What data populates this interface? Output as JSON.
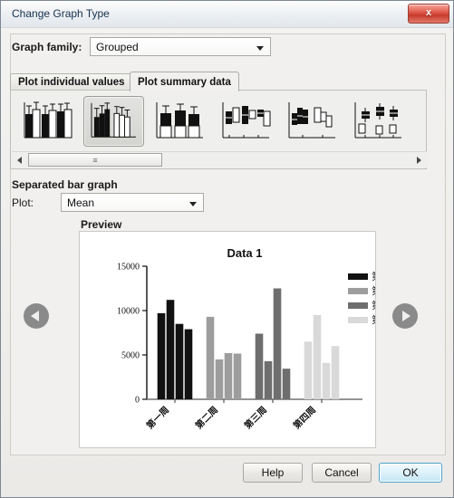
{
  "window": {
    "title": "Change Graph Type",
    "close_icon": "close-icon",
    "close_label": "x"
  },
  "form": {
    "graph_family_label": "Graph family:",
    "graph_family_value": "Grouped",
    "graph_family_caret": "chevron-down-icon"
  },
  "tabs": [
    {
      "label": "Plot individual values",
      "selected": false
    },
    {
      "label": "Plot summary data",
      "selected": true
    }
  ],
  "thumbnails": {
    "items": [
      {
        "name": "interleaved-bar-graph",
        "selected": false
      },
      {
        "name": "separated-bar-graph",
        "selected": true
      },
      {
        "name": "stacked-bar-graph",
        "selected": false
      },
      {
        "name": "interleaved-box-plot",
        "selected": false
      },
      {
        "name": "separated-box-plot",
        "selected": false
      },
      {
        "name": "grouped-scatter-box",
        "selected": false
      }
    ],
    "scroll_left_icon": "triangle-left-icon",
    "scroll_right_icon": "triangle-right-icon",
    "scroll_grip": "≡"
  },
  "section": {
    "title": "Separated bar graph",
    "plot_label": "Plot:",
    "plot_value": "Mean",
    "plot_caret": "chevron-down-icon",
    "preview_label": "Preview"
  },
  "navigation": {
    "prev_icon": "circle-arrow-left-icon",
    "next_icon": "circle-arrow-right-icon"
  },
  "footer": {
    "help_label": "Help",
    "cancel_label": "Cancel",
    "ok_label": "OK",
    "ok_accent": "#4fa3c8"
  },
  "chart_data": {
    "type": "bar",
    "title": "Data 1",
    "xlabel": "",
    "ylabel": "",
    "ylim": [
      0,
      15000
    ],
    "yticks": [
      0,
      5000,
      10000,
      15000
    ],
    "ytick_labels": [
      "0",
      "5000",
      "10000",
      "15000"
    ],
    "grid": false,
    "legend_position": "right",
    "categories": [
      "第一周",
      "第二周",
      "第三周",
      "第四周"
    ],
    "series": [
      {
        "name": "第一周",
        "color": "#111111",
        "values": [
          9700,
          11200,
          8500,
          7900
        ]
      },
      {
        "name": "第二周",
        "color": "#9d9d9d",
        "values": [
          9300,
          4500,
          5200,
          5150
        ]
      },
      {
        "name": "第三周",
        "color": "#6e6e6e",
        "values": [
          7400,
          4300,
          12500,
          3450
        ]
      },
      {
        "name": "第四周",
        "color": "#d9d9d9",
        "values": [
          6500,
          9500,
          4100,
          6000
        ]
      }
    ],
    "legend_entries": [
      "第一周",
      "第二周",
      "第三周",
      "第四周"
    ]
  }
}
